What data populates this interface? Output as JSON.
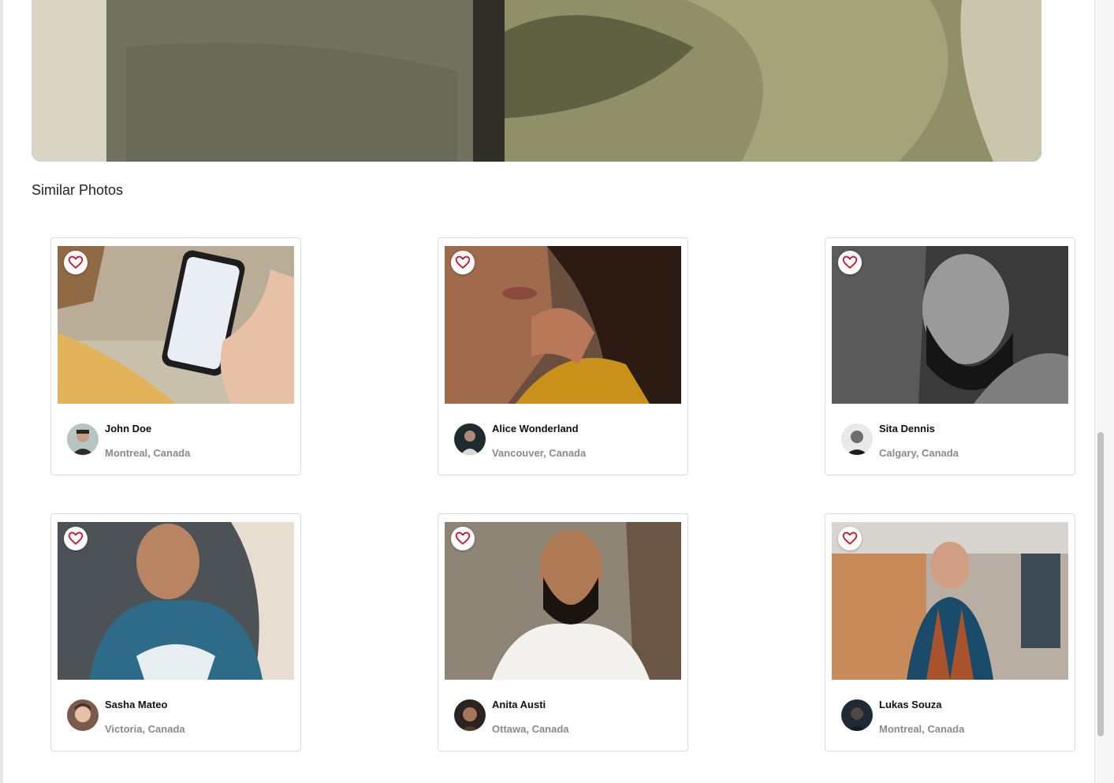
{
  "section": {
    "title": "Similar Photos"
  },
  "cards": [
    {
      "name": "John Doe",
      "location": "Montreal, Canada"
    },
    {
      "name": "Alice Wonderland",
      "location": "Vancouver, Canada"
    },
    {
      "name": "Sita Dennis",
      "location": "Calgary, Canada"
    },
    {
      "name": "Sasha Mateo",
      "location": "Victoria, Canada"
    },
    {
      "name": "Anita Austi",
      "location": "Ottawa, Canada"
    },
    {
      "name": "Lukas Souza",
      "location": "Montreal, Canada"
    }
  ],
  "icons": {
    "favorite": "heart-icon"
  },
  "colors": {
    "heart": "#d0021b",
    "card_border": "#dcdcdc",
    "location_text": "#8a8a8a"
  }
}
